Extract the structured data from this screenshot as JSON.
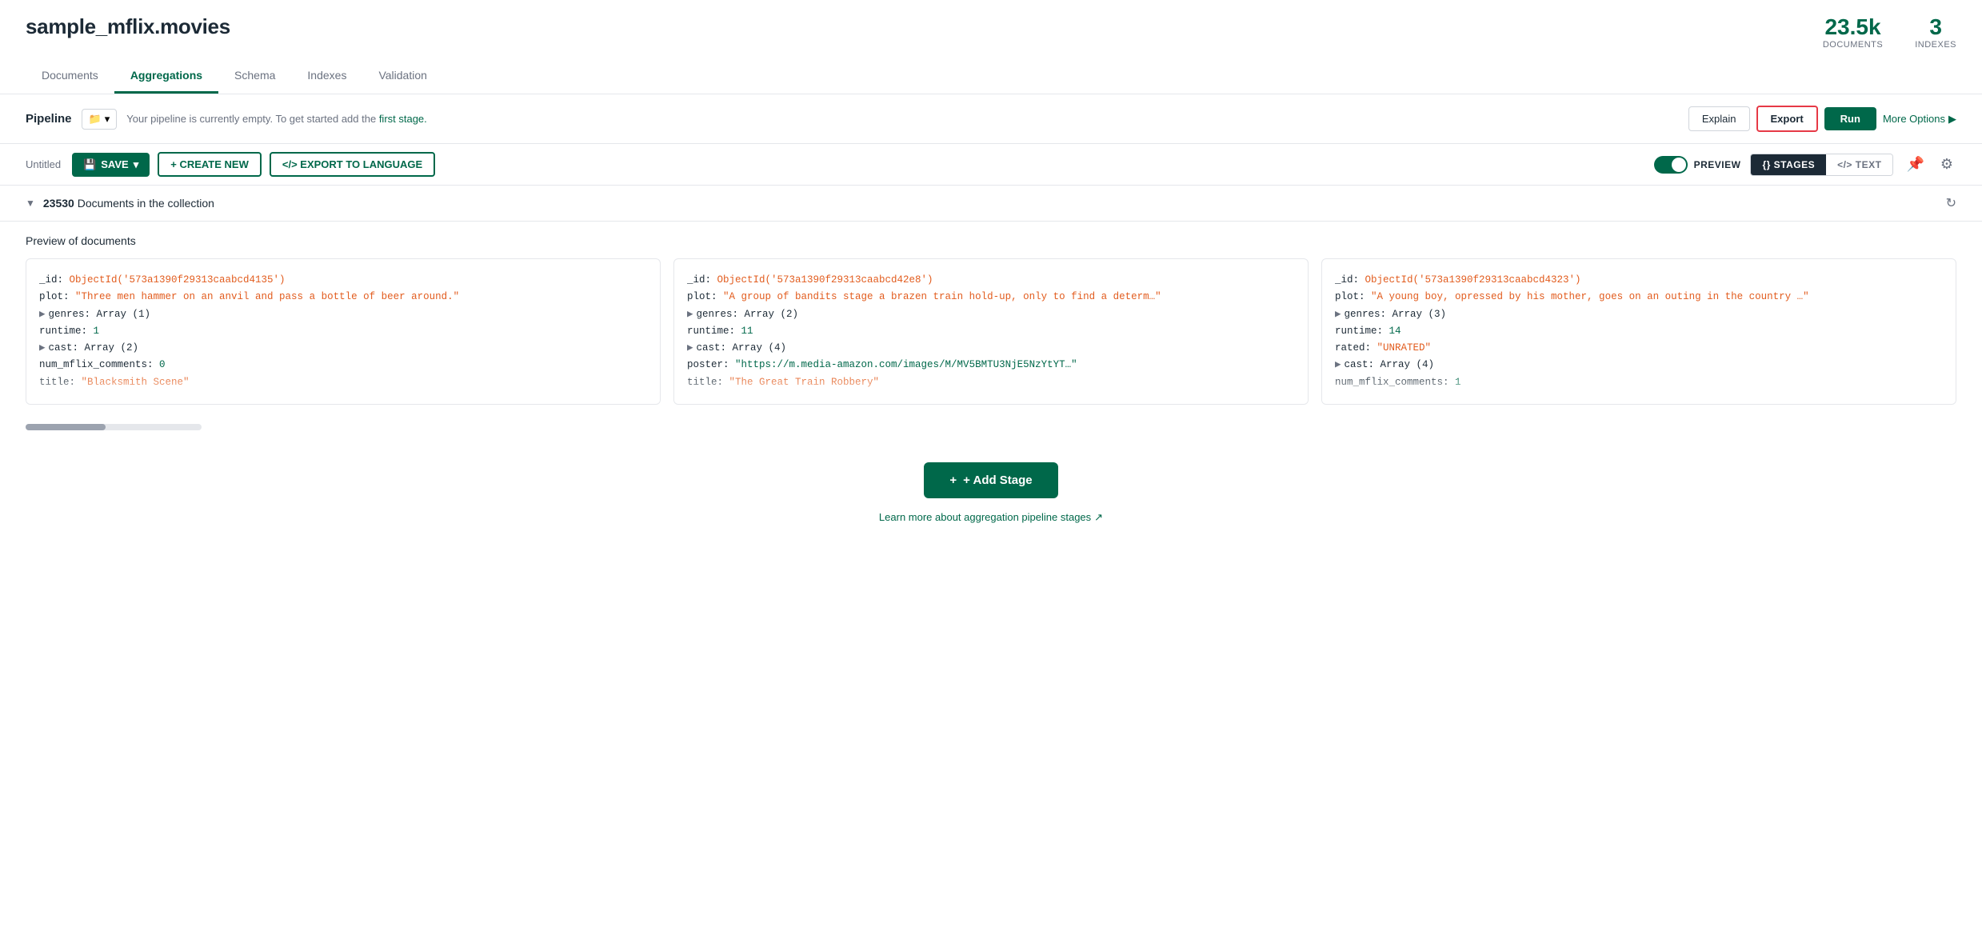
{
  "header": {
    "collection_name": "sample_mflix.movies",
    "stats": {
      "documents_count": "23.5k",
      "documents_label": "DOCUMENTS",
      "indexes_count": "3",
      "indexes_label": "INDEXES"
    }
  },
  "tabs": [
    {
      "label": "Documents",
      "active": false
    },
    {
      "label": "Aggregations",
      "active": true
    },
    {
      "label": "Schema",
      "active": false
    },
    {
      "label": "Indexes",
      "active": false
    },
    {
      "label": "Validation",
      "active": false
    }
  ],
  "pipeline_bar": {
    "label": "Pipeline",
    "empty_text": "Your pipeline is currently empty. To get started add the ",
    "link_text": "first stage.",
    "explain_label": "Explain",
    "export_label": "Export",
    "run_label": "Run",
    "more_options_label": "More Options"
  },
  "toolbar": {
    "title_label": "Untitled",
    "save_label": "SAVE",
    "create_new_label": "+ CREATE NEW",
    "export_lang_label": "</> EXPORT TO LANGUAGE",
    "preview_label": "PREVIEW",
    "stages_label": "{} STAGES",
    "text_label": "</> TEXT"
  },
  "collection_info": {
    "count": "23530",
    "count_label": "Documents",
    "suffix": "in the collection"
  },
  "preview": {
    "label": "Preview of documents",
    "documents": [
      {
        "id": "ObjectId('573a1390f29313caabcd4135')",
        "plot": "\"Three men hammer on an anvil and pass a bottle of beer around.\"",
        "genres_label": "genres:",
        "genres_val": "Array (1)",
        "runtime_label": "runtime:",
        "runtime_val": "1",
        "cast_label": "cast:",
        "cast_val": "Array (2)",
        "comments_label": "num_mflix_comments:",
        "comments_val": "0",
        "title_label": "title:",
        "title_val": "\"Blacksmith Scene\""
      },
      {
        "id": "ObjectId('573a1390f29313caabcd42e8')",
        "plot": "\"A group of bandits stage a brazen train hold-up, only to find a determ…\"",
        "genres_label": "genres:",
        "genres_val": "Array (2)",
        "runtime_label": "runtime:",
        "runtime_val": "11",
        "cast_label": "cast:",
        "cast_val": "Array (4)",
        "poster_label": "poster:",
        "poster_val": "\"https://m.media-amazon.com/images/M/MV5BMTU3NjE5NzYtYT…\"",
        "title_label": "title:",
        "title_val": "\"The Great Train Robbery\""
      },
      {
        "id": "ObjectId('573a1390f29313caabcd4323')",
        "plot": "\"A young boy, opressed by his mother, goes on an outing in the country …\"",
        "genres_label": "genres:",
        "genres_val": "Array (3)",
        "runtime_label": "runtime:",
        "runtime_val": "14",
        "rated_label": "rated:",
        "rated_val": "\"UNRATED\"",
        "cast_label": "cast:",
        "cast_val": "Array (4)",
        "comments_label": "num_mflix_comments:",
        "comments_val": "1"
      }
    ]
  },
  "add_stage": {
    "button_label": "+ Add Stage",
    "learn_more_text": "Learn more about aggregation pipeline stages",
    "learn_more_icon": "↗"
  }
}
